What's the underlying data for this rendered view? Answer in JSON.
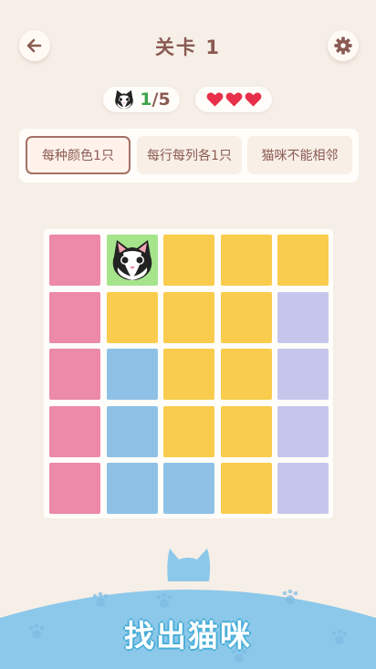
{
  "header": {
    "title": "关卡 1",
    "back_icon": "arrow-left-icon",
    "settings_icon": "gear-icon"
  },
  "status": {
    "cats_found": "1",
    "cats_total": "/5",
    "lives": 3,
    "found_color": "#3ea44a",
    "heart_color": "#e8304a"
  },
  "rules": [
    {
      "label": "每种颜色1只",
      "selected": true
    },
    {
      "label": "每行每列各1只",
      "selected": false
    },
    {
      "label": "猫咪不能相邻",
      "selected": false
    }
  ],
  "board": {
    "size": 5,
    "colors": {
      "pink": "#ec8aa8",
      "yellow": "#f9cc4d",
      "blue": "#8fc1e6",
      "purple": "#c6c6ec",
      "found": "#a6e48c"
    },
    "grid": [
      [
        "pink",
        "yellow",
        "yellow",
        "yellow",
        "yellow"
      ],
      [
        "pink",
        "yellow",
        "yellow",
        "yellow",
        "purple"
      ],
      [
        "pink",
        "blue",
        "yellow",
        "yellow",
        "purple"
      ],
      [
        "pink",
        "blue",
        "yellow",
        "yellow",
        "purple"
      ],
      [
        "pink",
        "blue",
        "blue",
        "yellow",
        "purple"
      ]
    ],
    "cats": [
      {
        "row": 0,
        "col": 1
      }
    ]
  },
  "footer": {
    "cta_label": "找出猫咪"
  }
}
